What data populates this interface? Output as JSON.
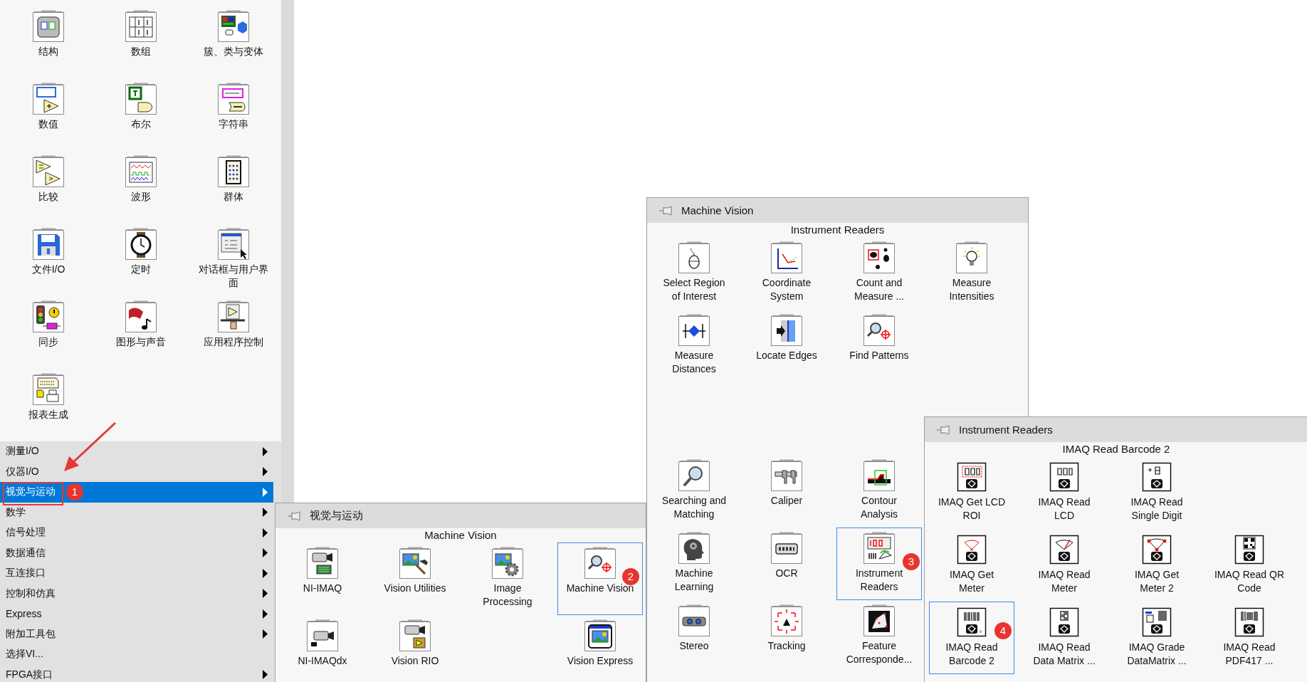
{
  "palette": {
    "items": [
      {
        "label": "结构"
      },
      {
        "label": "数组"
      },
      {
        "label": "簇、类与变体"
      },
      {
        "label": "数值"
      },
      {
        "label": "布尔"
      },
      {
        "label": "字符串"
      },
      {
        "label": "比较"
      },
      {
        "label": "波形"
      },
      {
        "label": "群体"
      },
      {
        "label": "文件I/O"
      },
      {
        "label": "定时"
      },
      {
        "label": "对话框与用户界面"
      },
      {
        "label": "同步"
      },
      {
        "label": "图形与声音"
      },
      {
        "label": "应用程序控制"
      },
      {
        "label": "报表生成"
      }
    ]
  },
  "category_menu": {
    "items": [
      {
        "label": "测量I/O",
        "selected": false,
        "has_submenu": true
      },
      {
        "label": "仪器I/O",
        "selected": false,
        "has_submenu": true
      },
      {
        "label": "视觉与运动",
        "selected": true,
        "has_submenu": true
      },
      {
        "label": "数学",
        "selected": false,
        "has_submenu": true
      },
      {
        "label": "信号处理",
        "selected": false,
        "has_submenu": true
      },
      {
        "label": "数据通信",
        "selected": false,
        "has_submenu": true
      },
      {
        "label": "互连接口",
        "selected": false,
        "has_submenu": true
      },
      {
        "label": "控制和仿真",
        "selected": false,
        "has_submenu": true
      },
      {
        "label": "Express",
        "selected": false,
        "has_submenu": true
      },
      {
        "label": "附加工具包",
        "selected": false,
        "has_submenu": true
      },
      {
        "label": "选择VI...",
        "selected": false,
        "has_submenu": false
      },
      {
        "label": "FPGA接口",
        "selected": false,
        "has_submenu": true
      }
    ]
  },
  "submenus": [
    {
      "title": "视觉与运动",
      "caption": "Machine Vision",
      "items": [
        {
          "label": "NI-IMAQ",
          "selected": false
        },
        {
          "label": "Vision Utilities",
          "selected": false
        },
        {
          "label": "Image Processing",
          "selected": false
        },
        {
          "label": "Machine Vision",
          "selected": true
        },
        {
          "label": "NI-IMAQdx",
          "selected": false
        },
        {
          "label": "Vision RIO",
          "selected": false
        },
        {
          "label": "Vision Express",
          "selected": false
        }
      ]
    },
    {
      "title": "Machine Vision",
      "caption": "Instrument Readers",
      "items": [
        {
          "label": "Select Region of Interest",
          "selected": false
        },
        {
          "label": "Coordinate System",
          "selected": false
        },
        {
          "label": "Count and Measure ...",
          "selected": false
        },
        {
          "label": "Measure Intensities",
          "selected": false
        },
        {
          "label": "Measure Distances",
          "selected": false
        },
        {
          "label": "Locate Edges",
          "selected": false
        },
        {
          "label": "Find Patterns",
          "selected": false
        },
        {
          "label": "Searching and Matching",
          "selected": false
        },
        {
          "label": "Caliper",
          "selected": false
        },
        {
          "label": "Contour Analysis",
          "selected": false
        },
        {
          "label": "Machine Learning",
          "selected": false
        },
        {
          "label": "OCR",
          "selected": false
        },
        {
          "label": "Instrument Readers",
          "selected": true
        },
        {
          "label": "Stereo",
          "selected": false
        },
        {
          "label": "Tracking",
          "selected": false
        },
        {
          "label": "Feature Corresponde...",
          "selected": false
        }
      ]
    },
    {
      "title": "Instrument Readers",
      "caption": "IMAQ Read Barcode 2",
      "items": [
        {
          "label": "IMAQ Get LCD ROI",
          "selected": false
        },
        {
          "label": "IMAQ Read LCD",
          "selected": false
        },
        {
          "label": "IMAQ Read Single Digit",
          "selected": false
        },
        {
          "label": "IMAQ Get Meter",
          "selected": false
        },
        {
          "label": "IMAQ Read Meter",
          "selected": false
        },
        {
          "label": "IMAQ Get Meter 2",
          "selected": false
        },
        {
          "label": "IMAQ Read QR Code",
          "selected": false
        },
        {
          "label": "IMAQ Read Barcode 2",
          "selected": true
        },
        {
          "label": "IMAQ Read Data Matrix ...",
          "selected": false
        },
        {
          "label": "IMAQ Grade DataMatrix ...",
          "selected": false
        },
        {
          "label": "IMAQ Read PDF417 ...",
          "selected": false
        }
      ]
    }
  ],
  "annotations": [
    {
      "label": "1"
    },
    {
      "label": "2"
    },
    {
      "label": "3"
    },
    {
      "label": "4"
    }
  ]
}
